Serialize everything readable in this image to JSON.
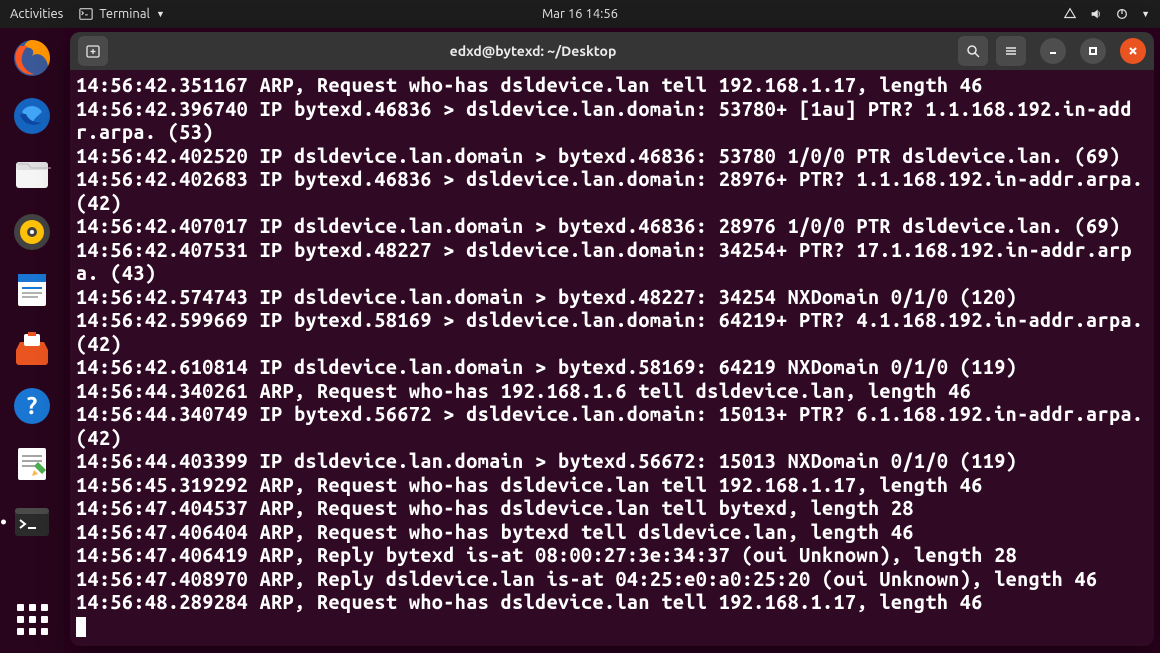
{
  "topbar": {
    "activities": "Activities",
    "app_menu": "Terminal",
    "clock": "Mar 16  14:56"
  },
  "dock": {
    "items": [
      {
        "name": "firefox-icon"
      },
      {
        "name": "thunderbird-icon"
      },
      {
        "name": "files-icon"
      },
      {
        "name": "rhythmbox-icon"
      },
      {
        "name": "writer-icon"
      },
      {
        "name": "software-icon"
      },
      {
        "name": "help-icon"
      },
      {
        "name": "texteditor-icon"
      },
      {
        "name": "terminal-icon"
      }
    ]
  },
  "window": {
    "title": "edxd@bytexd: ~/Desktop"
  },
  "terminal": {
    "lines": [
      "14:56:42.351167 ARP, Request who-has dsldevice.lan tell 192.168.1.17, length 46",
      "14:56:42.396740 IP bytexd.46836 > dsldevice.lan.domain: 53780+ [1au] PTR? 1.1.168.192.in-addr.arpa. (53)",
      "14:56:42.402520 IP dsldevice.lan.domain > bytexd.46836: 53780 1/0/0 PTR dsldevice.lan. (69)",
      "14:56:42.402683 IP bytexd.46836 > dsldevice.lan.domain: 28976+ PTR? 1.1.168.192.in-addr.arpa. (42)",
      "14:56:42.407017 IP dsldevice.lan.domain > bytexd.46836: 28976 1/0/0 PTR dsldevice.lan. (69)",
      "14:56:42.407531 IP bytexd.48227 > dsldevice.lan.domain: 34254+ PTR? 17.1.168.192.in-addr.arpa. (43)",
      "14:56:42.574743 IP dsldevice.lan.domain > bytexd.48227: 34254 NXDomain 0/1/0 (120)",
      "14:56:42.599669 IP bytexd.58169 > dsldevice.lan.domain: 64219+ PTR? 4.1.168.192.in-addr.arpa. (42)",
      "14:56:42.610814 IP dsldevice.lan.domain > bytexd.58169: 64219 NXDomain 0/1/0 (119)",
      "14:56:44.340261 ARP, Request who-has 192.168.1.6 tell dsldevice.lan, length 46",
      "14:56:44.340749 IP bytexd.56672 > dsldevice.lan.domain: 15013+ PTR? 6.1.168.192.in-addr.arpa. (42)",
      "14:56:44.403399 IP dsldevice.lan.domain > bytexd.56672: 15013 NXDomain 0/1/0 (119)",
      "14:56:45.319292 ARP, Request who-has dsldevice.lan tell 192.168.1.17, length 46",
      "14:56:47.404537 ARP, Request who-has dsldevice.lan tell bytexd, length 28",
      "14:56:47.406404 ARP, Request who-has bytexd tell dsldevice.lan, length 46",
      "14:56:47.406419 ARP, Reply bytexd is-at 08:00:27:3e:34:37 (oui Unknown), length 28",
      "14:56:47.408970 ARP, Reply dsldevice.lan is-at 04:25:e0:a0:25:20 (oui Unknown), length 46",
      "14:56:48.289284 ARP, Request who-has dsldevice.lan tell 192.168.1.17, length 46"
    ]
  }
}
